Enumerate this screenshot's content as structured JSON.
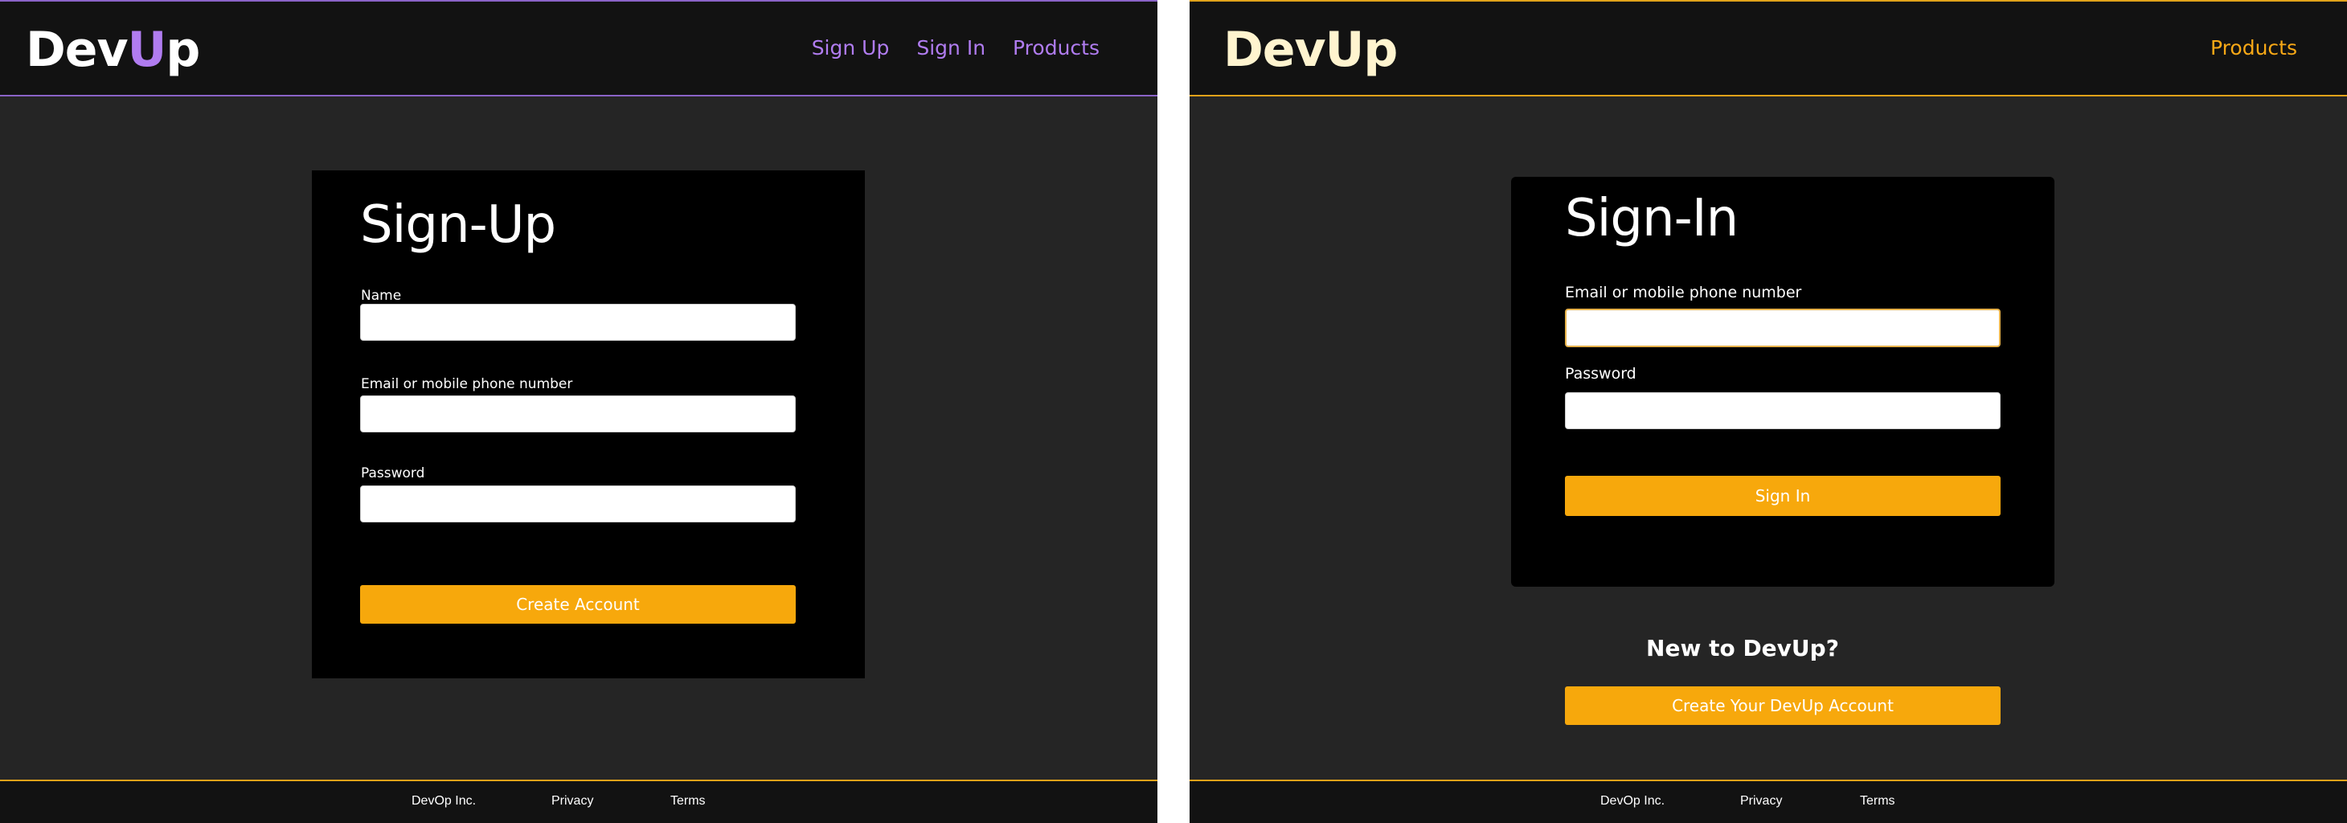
{
  "signup_page": {
    "logo": {
      "part1": "Dev",
      "part2": "U",
      "part3": "p"
    },
    "nav": [
      "Sign Up",
      "Sign In",
      "Products"
    ],
    "form": {
      "title": "Sign-Up",
      "name_label": "Name",
      "email_label": "Email or mobile phone number",
      "password_label": "Password",
      "submit_label": "Create Account"
    },
    "footer": [
      "DevOp Inc.",
      "Privacy",
      "Terms"
    ]
  },
  "signin_page": {
    "logo": "DevUp",
    "nav": [
      "Products"
    ],
    "form": {
      "title": "Sign-In",
      "email_label": "Email or mobile phone number",
      "password_label": "Password",
      "submit_label": "Sign In"
    },
    "new_to": "New to DevUp?",
    "create_label": "Create Your DevUp Account",
    "footer": [
      "DevOp Inc.",
      "Privacy",
      "Terms"
    ]
  },
  "colors": {
    "accent_purple": "#b07cf0",
    "accent_orange": "#f7a80c",
    "background": "#252525",
    "header": "#121212"
  }
}
